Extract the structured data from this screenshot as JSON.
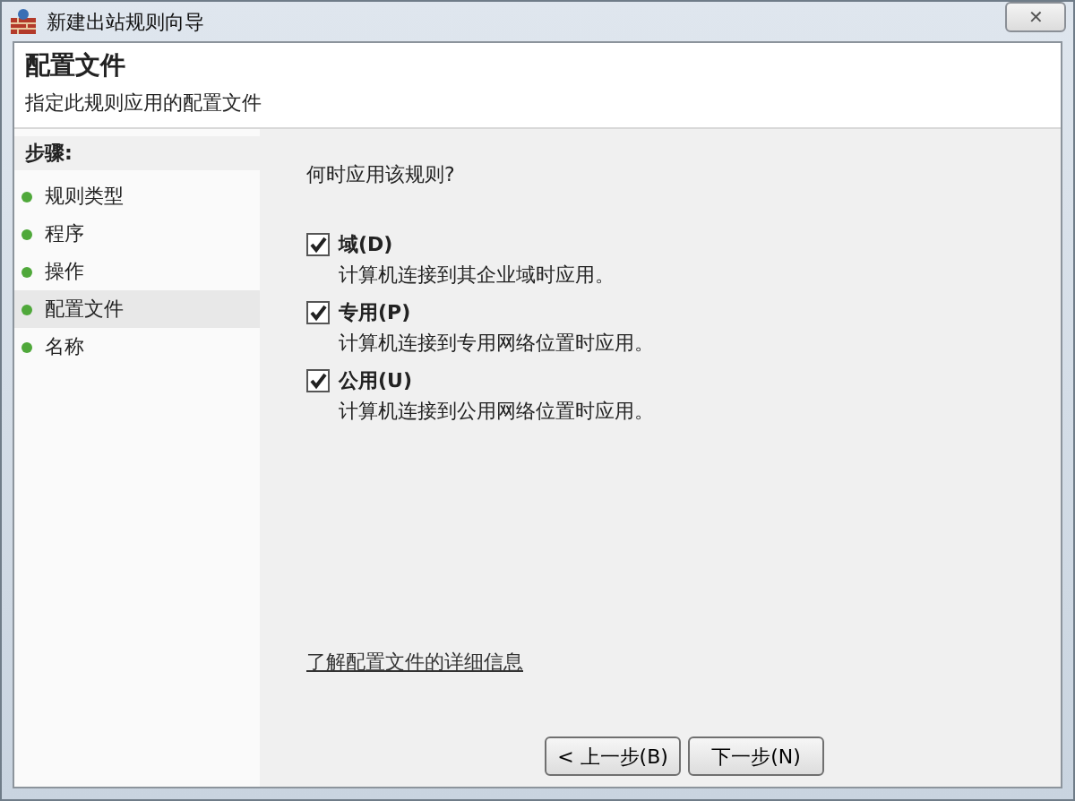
{
  "window": {
    "title": "新建出站规则向导",
    "close": "✕"
  },
  "header": {
    "title": "配置文件",
    "subtitle": "指定此规则应用的配置文件"
  },
  "steps": {
    "heading": "步骤:",
    "items": [
      {
        "label": "规则类型",
        "selected": false
      },
      {
        "label": "程序",
        "selected": false
      },
      {
        "label": "操作",
        "selected": false
      },
      {
        "label": "配置文件",
        "selected": true
      },
      {
        "label": "名称",
        "selected": false
      }
    ]
  },
  "content": {
    "question": "何时应用该规则?",
    "options": [
      {
        "label": "域(D)",
        "description": "计算机连接到其企业域时应用。",
        "checked": true
      },
      {
        "label": "专用(P)",
        "description": "计算机连接到专用网络位置时应用。",
        "checked": true
      },
      {
        "label": "公用(U)",
        "description": "计算机连接到公用网络位置时应用。",
        "checked": true
      }
    ],
    "link": "了解配置文件的详细信息"
  },
  "buttons": [
    "< 上一步(B)",
    "下一步(N)"
  ]
}
